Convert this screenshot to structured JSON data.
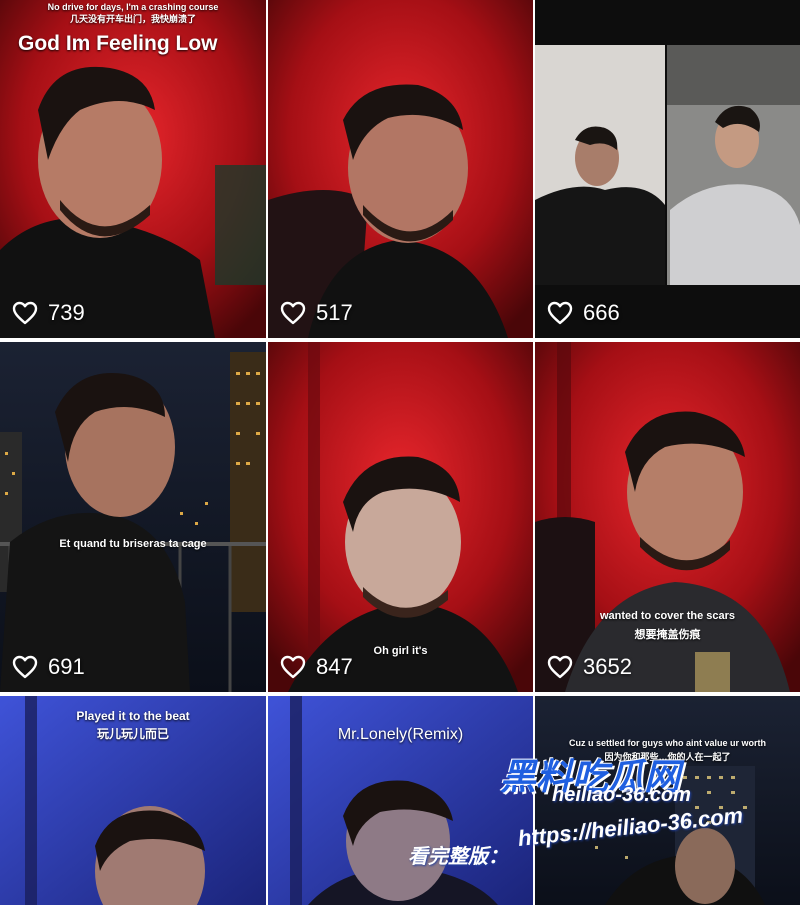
{
  "tiles": [
    {
      "caption_top": "No drive for days, I'm a crashing course",
      "caption_top_cn": "几天没有开车出门，我快崩溃了",
      "caption_main": "God Im Feeling Low",
      "likes": "739"
    },
    {
      "likes": "517"
    },
    {
      "likes": "666"
    },
    {
      "caption": "Et quand tu briseras ta cage",
      "likes": "691"
    },
    {
      "caption": "Oh girl it's",
      "likes": "847"
    },
    {
      "caption": "wanted to cover the scars",
      "caption_cn": "想要掩盖伤痕",
      "likes": "3652"
    },
    {
      "caption": "Played it to the beat",
      "caption_cn": "玩儿玩儿而已"
    },
    {
      "caption": "Mr.Lonely(Remix)"
    },
    {
      "caption": "Cuz u settled for guys who aint value ur worth",
      "caption_cn": "因为你和那些…你的人在一起了"
    }
  ],
  "watermark": {
    "brand": "黑料吃瓜网",
    "url": "heiliao-36.com",
    "full_label": "看完整版：",
    "full_url": "https://heiliao-36.com"
  },
  "icons": {
    "like": "heart-outline-icon"
  },
  "colors": {
    "red_bg": "#b3141b",
    "dark_bg": "#111111",
    "blue_bg": "#2a3bb0",
    "watermark_blue": "#1f5fe0"
  }
}
